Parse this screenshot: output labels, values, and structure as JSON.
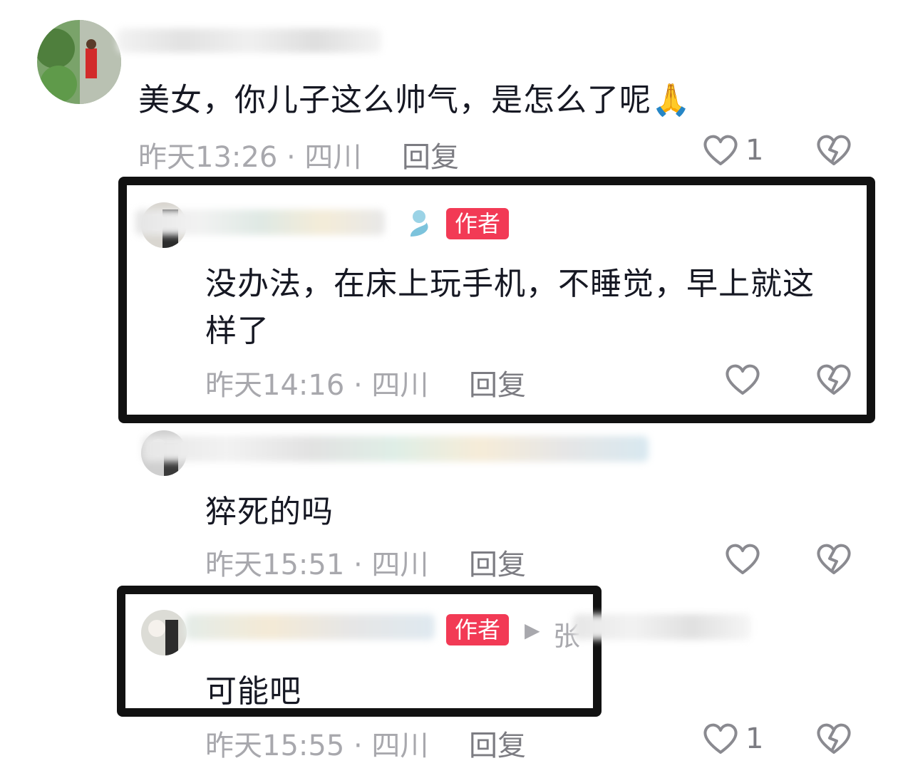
{
  "comments": [
    {
      "text": "美女，你儿子这么帅气，是怎么了呢",
      "emoji": "🙏",
      "time": "昨天13:26 · 四川",
      "reply_label": "回复",
      "likes": "1"
    },
    {
      "badge": "作者",
      "text_line1": "没办法，在床上玩手机，不睡觉，早上就这",
      "text_line2": "样了",
      "time": "昨天14:16 · 四川",
      "reply_label": "回复"
    },
    {
      "text": "猝死的吗",
      "time": "昨天15:51 · 四川",
      "reply_label": "回复"
    },
    {
      "badge": "作者",
      "reply_arrow": "▶",
      "reply_target_initial": "张",
      "text": "可能吧",
      "time": "昨天15:55 · 四川",
      "reply_label": "回复",
      "likes": "1"
    }
  ],
  "icons": {
    "like": "heart-outline-icon",
    "dislike": "broken-heart-icon"
  },
  "colors": {
    "badge": "#f23a55",
    "meta_text": "#a8a8ad",
    "frame": "#111111"
  }
}
